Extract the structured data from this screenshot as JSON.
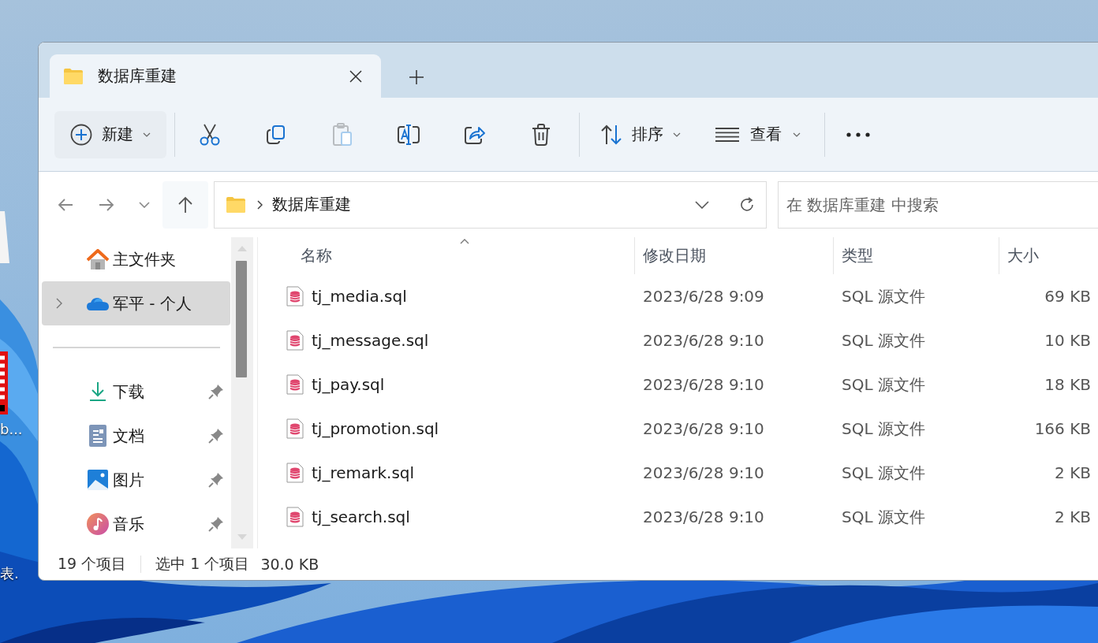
{
  "desktop": {
    "icon_labels": [
      "b...",
      "表."
    ]
  },
  "window": {
    "tabs": [
      {
        "title": "数据库重建",
        "selected": true
      }
    ]
  },
  "toolbar": {
    "new_label": "新建",
    "actions": [
      {
        "kind": "cut",
        "disabled": false
      },
      {
        "kind": "copy",
        "disabled": false
      },
      {
        "kind": "paste",
        "disabled": true
      },
      {
        "kind": "rename",
        "disabled": false
      },
      {
        "kind": "share",
        "disabled": false
      },
      {
        "kind": "delete",
        "disabled": false
      }
    ],
    "sort_label": "排序",
    "view_label": "查看"
  },
  "address_bar": {
    "path": [
      "数据库重建"
    ]
  },
  "search": {
    "placeholder": "在 数据库重建 中搜索"
  },
  "nav_pane": {
    "groups": [
      {
        "items": [
          {
            "kind": "home",
            "label": "主文件夹",
            "selected": false,
            "expandable": false,
            "pinned": false
          },
          {
            "kind": "cloud",
            "label": "军平 - 个人",
            "selected": true,
            "expandable": true,
            "pinned": false
          }
        ]
      },
      {
        "items": [
          {
            "kind": "download",
            "label": "下载",
            "selected": false,
            "expandable": false,
            "pinned": true
          },
          {
            "kind": "documents",
            "label": "文档",
            "selected": false,
            "expandable": false,
            "pinned": true
          },
          {
            "kind": "pictures",
            "label": "图片",
            "selected": false,
            "expandable": false,
            "pinned": true
          },
          {
            "kind": "music",
            "label": "音乐",
            "selected": false,
            "expandable": false,
            "pinned": true
          }
        ]
      }
    ]
  },
  "table": {
    "columns": [
      {
        "label": "名称",
        "sorted": true
      },
      {
        "label": "修改日期",
        "sorted": false
      },
      {
        "label": "类型",
        "sorted": false
      },
      {
        "label": "大小",
        "sorted": false
      }
    ],
    "rows": [
      {
        "name": "tj_media.sql",
        "modified": "2023/6/28 9:09",
        "type": "SQL 源文件",
        "size": "69 KB",
        "selected": false
      },
      {
        "name": "tj_message.sql",
        "modified": "2023/6/28 9:10",
        "type": "SQL 源文件",
        "size": "10 KB",
        "selected": false
      },
      {
        "name": "tj_pay.sql",
        "modified": "2023/6/28 9:10",
        "type": "SQL 源文件",
        "size": "18 KB",
        "selected": false
      },
      {
        "name": "tj_promotion.sql",
        "modified": "2023/6/28 9:10",
        "type": "SQL 源文件",
        "size": "166 KB",
        "selected": false
      },
      {
        "name": "tj_remark.sql",
        "modified": "2023/6/28 9:10",
        "type": "SQL 源文件",
        "size": "2 KB",
        "selected": false
      },
      {
        "name": "tj_search.sql",
        "modified": "2023/6/28 9:10",
        "type": "SQL 源文件",
        "size": "2 KB",
        "selected": false
      }
    ]
  },
  "status_bar": {
    "item_count": "19 个项目",
    "selection": "选中 1 个项目",
    "selection_size": "30.0 KB"
  }
}
